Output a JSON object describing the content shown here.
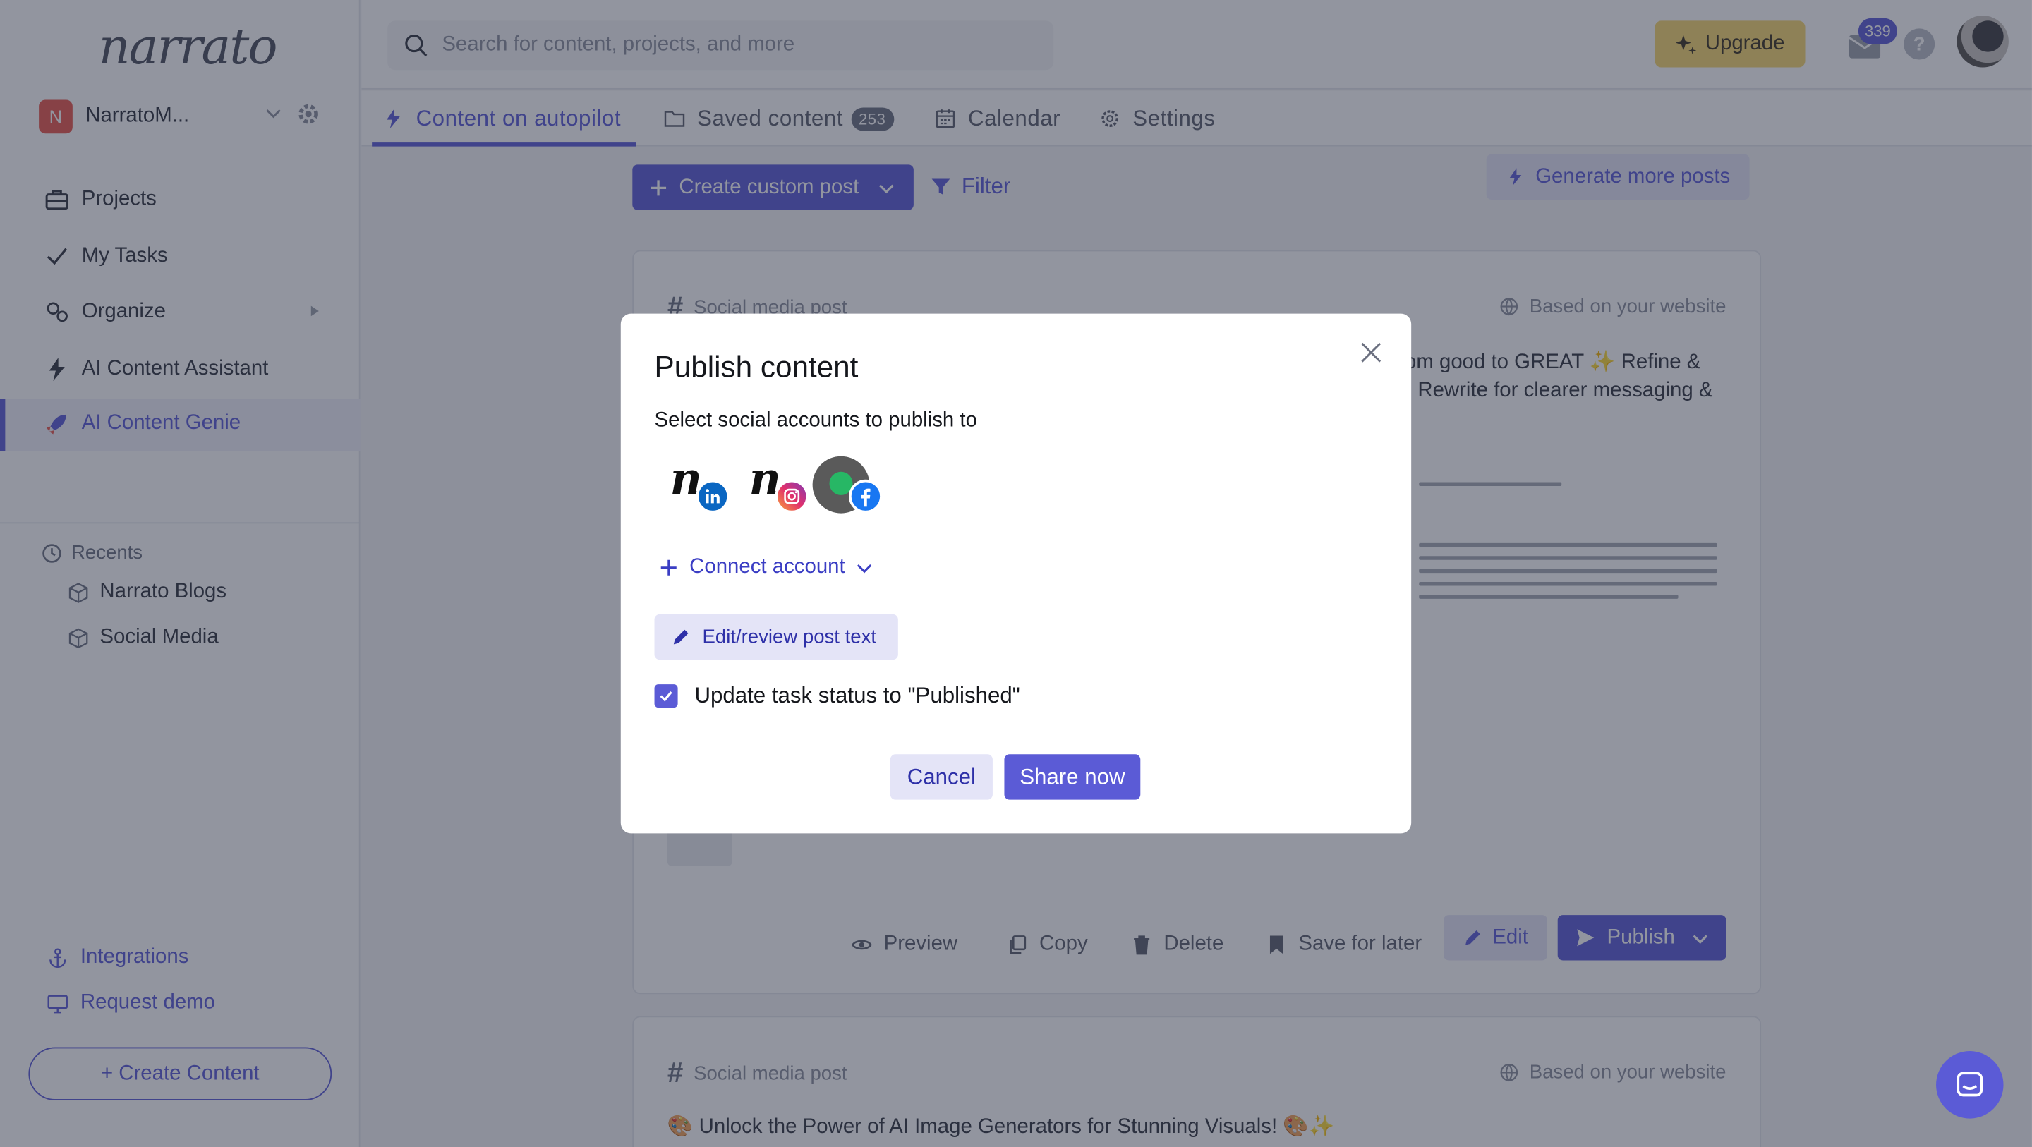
{
  "app": {
    "logo": "narrato",
    "workspace": {
      "initial": "N",
      "name": "NarratoM..."
    }
  },
  "sidebar": {
    "items": [
      {
        "label": "Projects",
        "icon": "briefcase-icon"
      },
      {
        "label": "My Tasks",
        "icon": "check-icon"
      },
      {
        "label": "Organize",
        "icon": "gears-icon"
      },
      {
        "label": "AI Content Assistant",
        "icon": "lightning-icon"
      },
      {
        "label": "AI Content Genie",
        "icon": "rocket-icon",
        "active": true
      }
    ],
    "recents_label": "Recents",
    "recents": [
      "Narrato Blogs",
      "Social Media"
    ],
    "footer": [
      {
        "label": "Integrations",
        "icon": "anchor-icon"
      },
      {
        "label": "Request demo",
        "icon": "monitor-icon"
      }
    ],
    "create_button": "+ Create Content"
  },
  "header": {
    "search_placeholder": "Search for content, projects, and more",
    "upgrade_label": "Upgrade",
    "notification_count": "339",
    "help_label": "?"
  },
  "tabs": [
    {
      "label": "Content on autopilot",
      "icon": "lightning-icon",
      "active": true
    },
    {
      "label": "Saved content",
      "icon": "folder-icon",
      "count": "253"
    },
    {
      "label": "Calendar",
      "icon": "calendar-icon"
    },
    {
      "label": "Settings",
      "icon": "gear-icon"
    }
  ],
  "toolbar": {
    "create_custom_post": "Create custom post",
    "filter": "Filter",
    "generate_more": "Generate more posts"
  },
  "cards": [
    {
      "kind": "Social media post",
      "source": "Based on your website",
      "text_line1": "om good to GREAT ✨ Refine &",
      "text_line2": "Rewrite for clearer messaging &",
      "actions": {
        "preview": "Preview",
        "copy": "Copy",
        "delete": "Delete",
        "save_for_later": "Save for later",
        "edit": "Edit",
        "publish": "Publish"
      }
    },
    {
      "kind": "Social media post",
      "source": "Based on your website",
      "text_line1": "🎨 Unlock the Power of AI Image Generators for Stunning Visuals! 🎨✨"
    }
  ],
  "modal": {
    "title": "Publish content",
    "subtitle": "Select social accounts to publish to",
    "accounts": [
      {
        "network": "LinkedIn",
        "icon": "linkedin-icon"
      },
      {
        "network": "Instagram",
        "icon": "instagram-icon"
      },
      {
        "network": "Facebook",
        "icon": "facebook-icon"
      }
    ],
    "connect_account": "Connect account",
    "edit_review": "Edit/review post text",
    "update_status_label": "Update task status to \"Published\"",
    "update_status_checked": true,
    "cancel": "Cancel",
    "share_now": "Share now"
  },
  "colors": {
    "accent": "#5b5bd6",
    "upgrade": "#f7d76e",
    "linkedin": "#0a66c2",
    "facebook": "#1877f2"
  }
}
